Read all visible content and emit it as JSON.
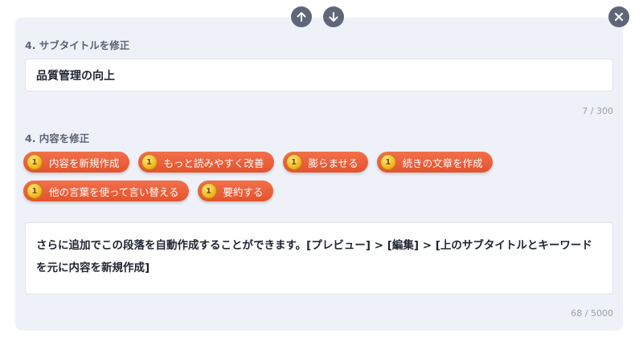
{
  "controls": {
    "move_up_icon": "arrow-up-icon",
    "move_down_icon": "arrow-down-icon",
    "close_icon": "close-icon"
  },
  "subtitle_section": {
    "label": "4. サブタイトルを修正",
    "value": "品質管理の向上",
    "counter": "7 / 300"
  },
  "content_section": {
    "label": "4. 内容を修正",
    "chip_cost": "1",
    "actions": [
      {
        "label": "内容を新規作成"
      },
      {
        "label": "もっと読みやすく改善"
      },
      {
        "label": "膨らませる"
      },
      {
        "label": "続きの文章を作成"
      },
      {
        "label": "他の言葉を使って言い替える"
      },
      {
        "label": "要約する"
      }
    ],
    "text": "さらに追加でこの段落を自動作成することができます。[プレビュー] > [編集] > [上のサブタイトルとキーワードを元に内容を新規作成]",
    "counter": "68 / 5000"
  },
  "colors": {
    "chip": "#e95a33",
    "coin": "#f3b71d",
    "panel": "#eef1f7",
    "control": "#5f6678"
  }
}
